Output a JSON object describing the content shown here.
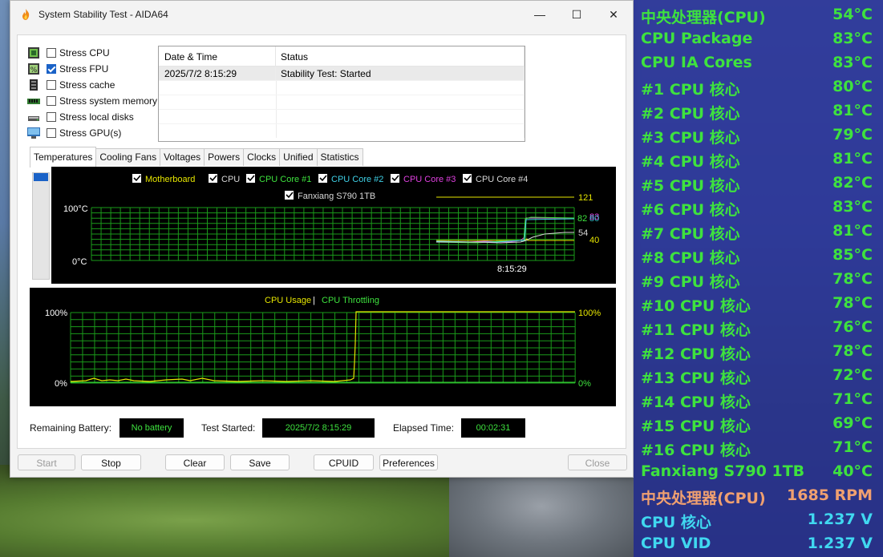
{
  "window": {
    "title": "System Stability Test - AIDA64",
    "minimize_glyph": "—",
    "maximize_glyph": "☐",
    "close_glyph": "✕"
  },
  "stress": [
    {
      "label": "Stress CPU",
      "checked": false,
      "icon": "cpu-chip-icon"
    },
    {
      "label": "Stress FPU",
      "checked": true,
      "icon": "fpu-percent-icon"
    },
    {
      "label": "Stress cache",
      "checked": false,
      "icon": "cache-icon"
    },
    {
      "label": "Stress system memory",
      "checked": false,
      "icon": "memory-stick-icon"
    },
    {
      "label": "Stress local disks",
      "checked": false,
      "icon": "disk-drive-icon"
    },
    {
      "label": "Stress GPU(s)",
      "checked": false,
      "icon": "monitor-icon"
    }
  ],
  "log": {
    "col_date": "Date & Time",
    "col_status": "Status",
    "rows": [
      {
        "date": "2025/7/2 8:15:29",
        "status": "Stability Test: Started"
      }
    ]
  },
  "tabs": [
    "Temperatures",
    "Cooling Fans",
    "Voltages",
    "Powers",
    "Clocks",
    "Unified",
    "Statistics"
  ],
  "temp_graph": {
    "legend_row1": [
      {
        "label": "Motherboard",
        "color": "#e6e600",
        "checked": true
      },
      {
        "label": "CPU",
        "color": "#d8d8d8",
        "checked": true
      },
      {
        "label": "CPU Core #1",
        "color": "#3ee23e",
        "checked": true
      },
      {
        "label": "CPU Core #2",
        "color": "#3fd0e6",
        "checked": true
      },
      {
        "label": "CPU Core #3",
        "color": "#e040e0",
        "checked": true
      },
      {
        "label": "CPU Core #4",
        "color": "#d8d8d8",
        "checked": true
      }
    ],
    "legend_row2": [
      {
        "label": "Fanxiang S790 1TB",
        "color": "#d8d8d8",
        "checked": true
      }
    ],
    "y_top": "100°C",
    "y_bottom": "0°C",
    "time_label": "8:15:29",
    "value_labels": [
      {
        "text": "121",
        "color": "#e6e600"
      },
      {
        "text": "82",
        "color": "#3ee23e"
      },
      {
        "text": "83",
        "color": "#e040e0"
      },
      {
        "text": "80",
        "color": "#3fd0e6"
      },
      {
        "text": "54",
        "color": "#d8d8d8"
      },
      {
        "text": "40",
        "color": "#e6e600"
      }
    ]
  },
  "cpu_graph": {
    "title_usage": "CPU Usage",
    "separator": "|",
    "title_throttle": "CPU Throttling",
    "y_top_left": "100%",
    "y_bottom_left": "0%",
    "y_top_right": "100%",
    "y_bottom_right": "0%"
  },
  "status": {
    "battery_label": "Remaining Battery:",
    "battery_value": "No battery",
    "started_label": "Test Started:",
    "started_value": "2025/7/2 8:15:29",
    "elapsed_label": "Elapsed Time:",
    "elapsed_value": "00:02:31"
  },
  "buttons": {
    "start": "Start",
    "stop": "Stop",
    "clear": "Clear",
    "save": "Save",
    "cpuid": "CPUID",
    "preferences": "Preferences",
    "close": "Close"
  },
  "osd": [
    {
      "label": "中央处理器(CPU)",
      "value": "54°C",
      "color": "#3ee23e"
    },
    {
      "label": "CPU Package",
      "value": "83°C",
      "color": "#3ee23e"
    },
    {
      "label": "CPU IA Cores",
      "value": "83°C",
      "color": "#3ee23e"
    },
    {
      "label": " #1 CPU 核心",
      "value": "80°C",
      "color": "#3ee23e"
    },
    {
      "label": " #2 CPU 核心",
      "value": "81°C",
      "color": "#3ee23e"
    },
    {
      "label": " #3 CPU 核心",
      "value": "79°C",
      "color": "#3ee23e"
    },
    {
      "label": " #4 CPU 核心",
      "value": "81°C",
      "color": "#3ee23e"
    },
    {
      "label": " #5 CPU 核心",
      "value": "82°C",
      "color": "#3ee23e"
    },
    {
      "label": " #6 CPU 核心",
      "value": "83°C",
      "color": "#3ee23e"
    },
    {
      "label": " #7 CPU 核心",
      "value": "81°C",
      "color": "#3ee23e"
    },
    {
      "label": " #8 CPU 核心",
      "value": "85°C",
      "color": "#3ee23e"
    },
    {
      "label": " #9 CPU 核心",
      "value": "78°C",
      "color": "#3ee23e"
    },
    {
      "label": " #10 CPU 核心",
      "value": "78°C",
      "color": "#3ee23e"
    },
    {
      "label": " #11 CPU 核心",
      "value": "76°C",
      "color": "#3ee23e"
    },
    {
      "label": " #12 CPU 核心",
      "value": "78°C",
      "color": "#3ee23e"
    },
    {
      "label": " #13 CPU 核心",
      "value": "72°C",
      "color": "#3ee23e"
    },
    {
      "label": " #14 CPU 核心",
      "value": "71°C",
      "color": "#3ee23e"
    },
    {
      "label": " #15 CPU 核心",
      "value": "69°C",
      "color": "#3ee23e"
    },
    {
      "label": " #16 CPU 核心",
      "value": "71°C",
      "color": "#3ee23e"
    },
    {
      "label": "Fanxiang S790 1TB",
      "value": "40°C",
      "color": "#3ee23e"
    },
    {
      "label": "中央处理器(CPU)",
      "value": "1685 RPM",
      "color": "#f0a070"
    },
    {
      "label": "CPU 核心",
      "value": "1.237 V",
      "color": "#40d8f0"
    },
    {
      "label": "CPU VID",
      "value": "1.237 V",
      "color": "#40d8f0"
    }
  ]
}
